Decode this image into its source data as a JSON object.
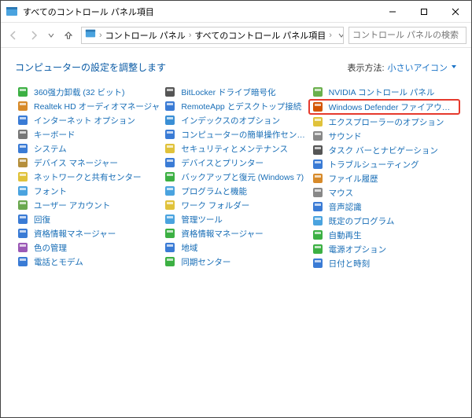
{
  "window": {
    "title": "すべてのコントロール パネル項目"
  },
  "breadcrumb": {
    "seg1": "コントロール パネル",
    "seg2": "すべてのコントロール パネル項目"
  },
  "search": {
    "placeholder": "コントロール パネルの検索"
  },
  "heading": "コンピューターの設定を調整します",
  "viewby": {
    "label": "表示方法:",
    "value": "小さいアイコン"
  },
  "col1": [
    {
      "label": "360强力卸载 (32 ビット)",
      "color": "#3cb043"
    },
    {
      "label": "Realtek HD オーディオマネージャ",
      "color": "#d78a2a"
    },
    {
      "label": "インターネット オプション",
      "color": "#3a7bd5"
    },
    {
      "label": "キーボード",
      "color": "#777"
    },
    {
      "label": "システム",
      "color": "#3a7bd5"
    },
    {
      "label": "デバイス マネージャー",
      "color": "#b58f3c"
    },
    {
      "label": "ネットワークと共有センター",
      "color": "#e0c23a"
    },
    {
      "label": "フォント",
      "color": "#4aa3df"
    },
    {
      "label": "ユーザー アカウント",
      "color": "#6aa84f"
    },
    {
      "label": "回復",
      "color": "#3a7bd5"
    },
    {
      "label": "資格情報マネージャー",
      "color": "#3a7bd5"
    },
    {
      "label": "色の管理",
      "color": "#9b59b6"
    },
    {
      "label": "電話とモデム",
      "color": "#3a7bd5"
    }
  ],
  "col2": [
    {
      "label": "BitLocker ドライブ暗号化",
      "color": "#555"
    },
    {
      "label": "RemoteApp とデスクトップ接続",
      "color": "#3a7bd5"
    },
    {
      "label": "インデックスのオプション",
      "color": "#3a8fd5"
    },
    {
      "label": "コンピューターの簡単操作センター",
      "color": "#3a7bd5"
    },
    {
      "label": "セキュリティとメンテナンス",
      "color": "#e0c23a"
    },
    {
      "label": "デバイスとプリンター",
      "color": "#3a7bd5"
    },
    {
      "label": "バックアップと復元 (Windows 7)",
      "color": "#3cb043"
    },
    {
      "label": "プログラムと機能",
      "color": "#4aa3df"
    },
    {
      "label": "ワーク フォルダー",
      "color": "#e0c23a"
    },
    {
      "label": "管理ツール",
      "color": "#4aa3df"
    },
    {
      "label": "資格情報マネージャー",
      "color": "#3cb043"
    },
    {
      "label": "地域",
      "color": "#3a7bd5"
    },
    {
      "label": "同期センター",
      "color": "#3cb043"
    }
  ],
  "col3": [
    {
      "label": "NVIDIA コントロール パネル",
      "color": "#6ab04c",
      "highlight": false
    },
    {
      "label": "Windows Defender ファイアウォール",
      "color": "#d35400",
      "highlight": true
    },
    {
      "label": "エクスプローラーのオプション",
      "color": "#e0c23a"
    },
    {
      "label": "サウンド",
      "color": "#888"
    },
    {
      "label": "タスク バーとナビゲーション",
      "color": "#555"
    },
    {
      "label": "トラブルシューティング",
      "color": "#3a7bd5"
    },
    {
      "label": "ファイル履歴",
      "color": "#d78a2a"
    },
    {
      "label": "マウス",
      "color": "#888"
    },
    {
      "label": "音声認識",
      "color": "#3a7bd5"
    },
    {
      "label": "既定のプログラム",
      "color": "#4aa3df"
    },
    {
      "label": "自動再生",
      "color": "#3cb043"
    },
    {
      "label": "電源オプション",
      "color": "#3cb043"
    },
    {
      "label": "日付と時刻",
      "color": "#3a7bd5"
    }
  ]
}
